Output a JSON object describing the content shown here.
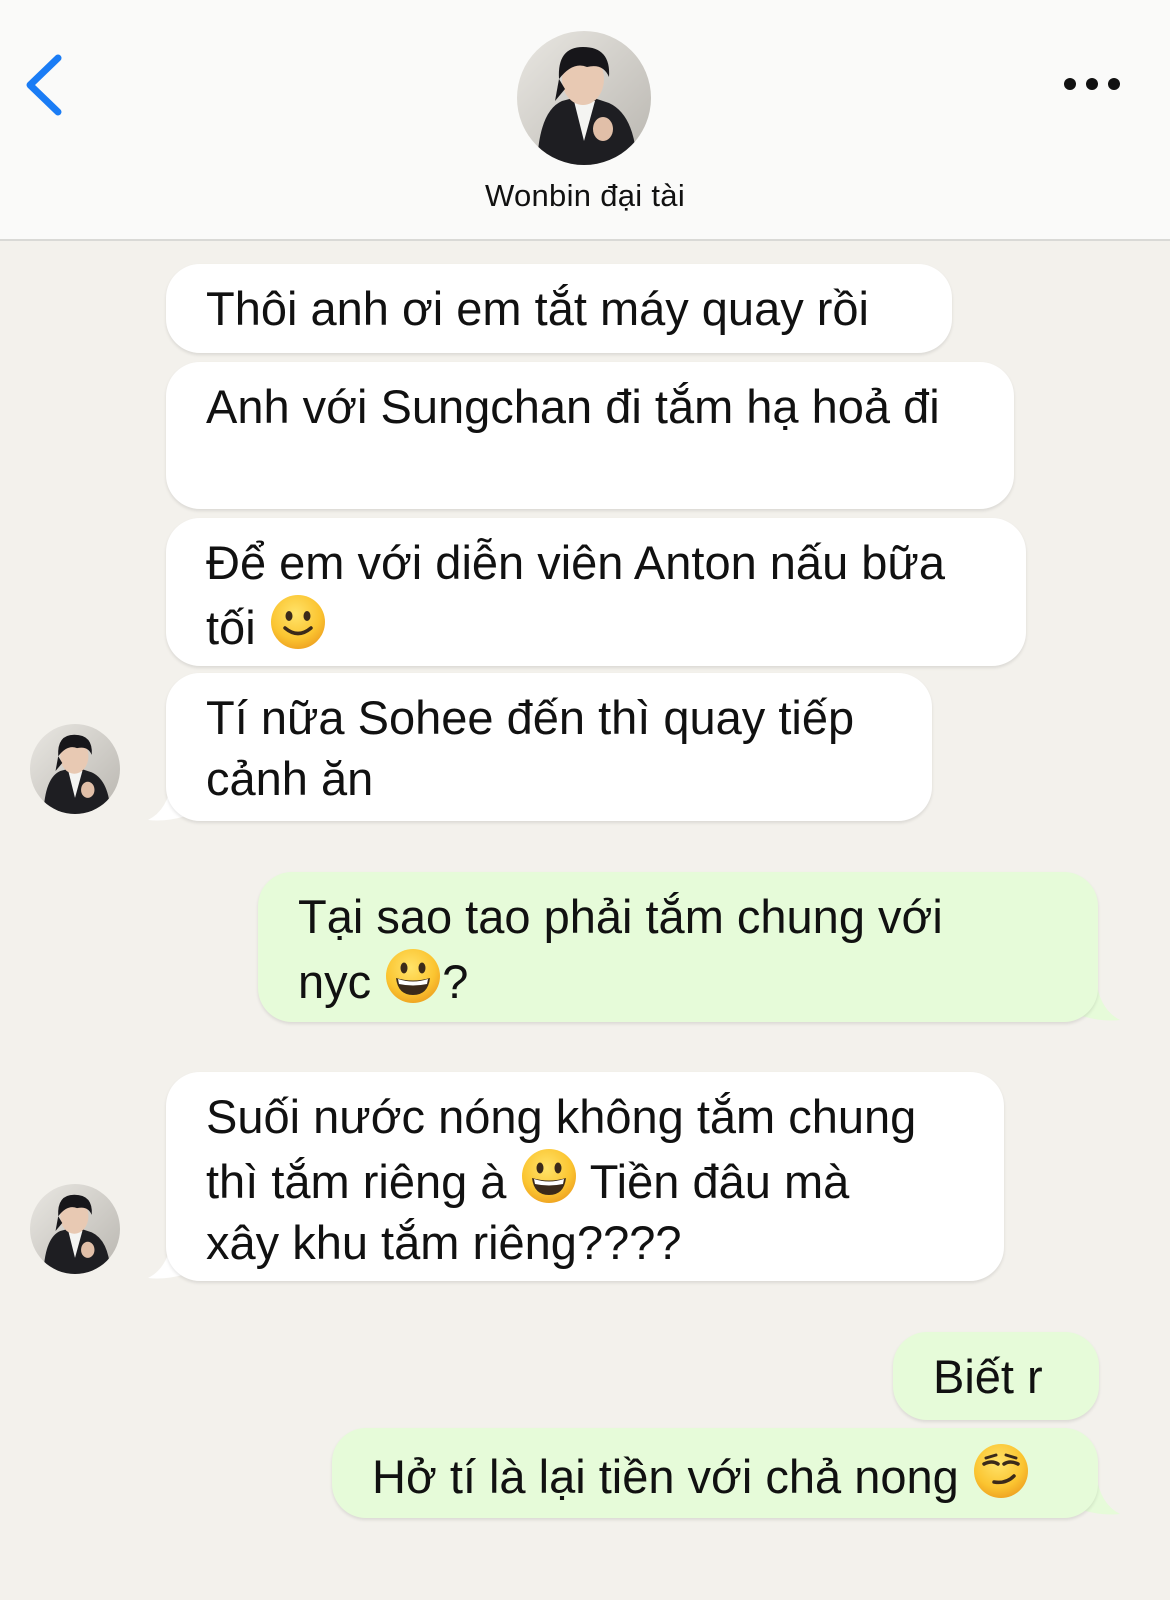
{
  "header": {
    "contact_name": "Wonbin đại tài",
    "back_icon": "chevron-left-icon",
    "more_icon": "ellipsis-icon",
    "accent_color": "#1a7cf5"
  },
  "colors": {
    "incoming_bubble": "#ffffff",
    "outgoing_bubble": "#e6fbd9",
    "background": "#f3f1ec"
  },
  "messages": [
    {
      "direction": "in",
      "text": "Thôi anh ơi em tắt máy quay rồi"
    },
    {
      "direction": "in",
      "text": "Anh với Sungchan đi tắm hạ hoả đi"
    },
    {
      "direction": "in",
      "text_a": "Để em với diễn viên Anton nấu bữa",
      "text_b": "tối",
      "emoji": "slightly-smiling-face-emoji"
    },
    {
      "direction": "in",
      "text_a": "Tí nữa Sohee đến thì quay tiếp",
      "text_b": "cảnh ăn"
    },
    {
      "direction": "out",
      "text_a": "Tại sao tao phải tắm chung với",
      "text_b": "nyc",
      "emoji": "grinning-face-emoji",
      "text_c": "?"
    },
    {
      "direction": "in",
      "text_a": "Suối nước nóng không tắm chung",
      "text_b": "thì tắm riêng à",
      "emoji": "grinning-face-emoji",
      "text_c": "Tiền đâu mà",
      "text_d": "xây khu tắm riêng????"
    },
    {
      "direction": "out",
      "text": "Biết r"
    },
    {
      "direction": "out",
      "text": "Hở tí là lại tiền với chả nong",
      "emoji": "smirking-face-emoji"
    }
  ]
}
